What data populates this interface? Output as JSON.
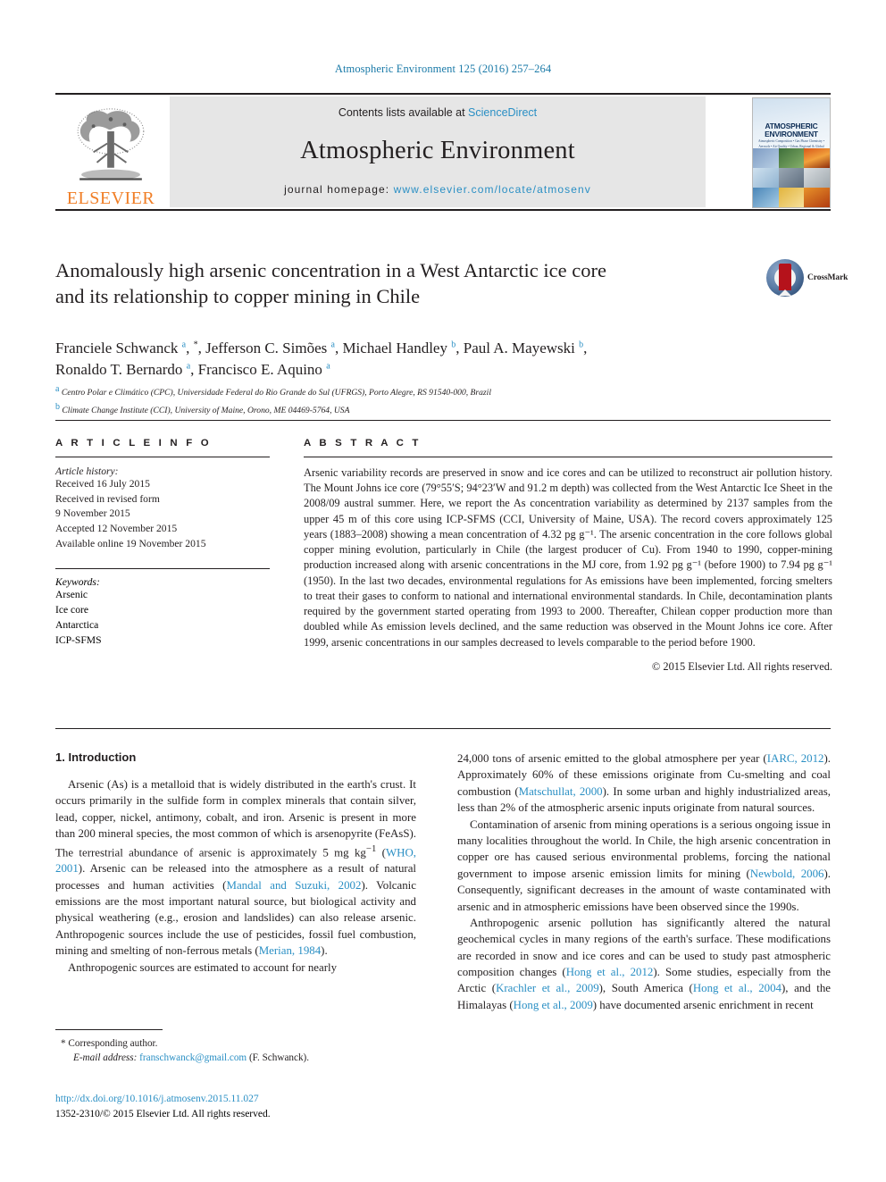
{
  "header": {
    "journal_reference": "Atmospheric Environment 125 (2016) 257–264"
  },
  "masthead": {
    "publisher_name": "ELSEVIER",
    "contents_prefix": "Contents lists available at ",
    "contents_link": "ScienceDirect",
    "journal_title": "Atmospheric Environment",
    "homepage_label": "journal homepage: ",
    "homepage_url": "www.elsevier.com/locate/atmosenv",
    "cover_title_line1": "ATMOSPHERIC",
    "cover_title_line2": "ENVIRONMENT",
    "cover_subtitle": "Atmospheric Composition • Gas Phase Chemistry • Aerosols • Air Quality • Urban, Regional & Global Scales"
  },
  "article": {
    "title_line1": "Anomalously high arsenic concentration in a West Antarctic ice core",
    "title_line2": "and its relationship to copper mining in Chile",
    "crossmark_label": "CrossMark",
    "authors_line1": "Franciele Schwanck <sup>a</sup>, <sup class=\"star\">*</sup>, Jefferson C. Simões <sup>a</sup>, Michael Handley <sup>b</sup>, Paul A. Mayewski <sup>b</sup>,",
    "authors_line2": "Ronaldo T. Bernardo <sup>a</sup>, Francisco E. Aquino <sup>a</sup>",
    "affiliation_a": "Centro Polar e Climático (CPC), Universidade Federal do Rio Grande do Sul (UFRGS), Porto Alegre, RS 91540-000, Brazil",
    "affiliation_b": "Climate Change Institute (CCI), University of Maine, Orono, ME 04469-5764, USA"
  },
  "article_info": {
    "heading": "A R T I C L E  I N F O",
    "history_label": "Article history:",
    "history": [
      "Received 16 July 2015",
      "Received in revised form",
      "9 November 2015",
      "Accepted 12 November 2015",
      "Available online 19 November 2015"
    ],
    "keywords_label": "Keywords:",
    "keywords": [
      "Arsenic",
      "Ice core",
      "Antarctica",
      "ICP-SFMS"
    ]
  },
  "abstract": {
    "heading": "A B S T R A C T",
    "text": "Arsenic variability records are preserved in snow and ice cores and can be utilized to reconstruct air pollution history. The Mount Johns ice core (79°55′S; 94°23′W and 91.2 m depth) was collected from the West Antarctic Ice Sheet in the 2008/09 austral summer. Here, we report the As concentration variability as determined by 2137 samples from the upper 45 m of this core using ICP-SFMS (CCI, University of Maine, USA). The record covers approximately 125 years (1883–2008) showing a mean concentration of 4.32 pg g⁻¹. The arsenic concentration in the core follows global copper mining evolution, particularly in Chile (the largest producer of Cu). From 1940 to 1990, copper-mining production increased along with arsenic concentrations in the MJ core, from 1.92 pg g⁻¹ (before 1900) to 7.94 pg g⁻¹ (1950). In the last two decades, environmental regulations for As emissions have been implemented, forcing smelters to treat their gases to conform to national and international environmental standards. In Chile, decontamination plants required by the government started operating from 1993 to 2000. Thereafter, Chilean copper production more than doubled while As emission levels declined, and the same reduction was observed in the Mount Johns ice core. After 1999, arsenic concentrations in our samples decreased to levels comparable to the period before 1900.",
    "copyright": "© 2015 Elsevier Ltd. All rights reserved."
  },
  "introduction": {
    "section_number_title": "1. Introduction",
    "left_paragraph_1_a": "Arsenic (As) is a metalloid that is widely distributed in the earth's crust. It occurs primarily in the sulfide form in complex minerals that contain silver, lead, copper, nickel, antimony, cobalt, and iron. Arsenic is present in more than 200 mineral species, the most common of which is arsenopyrite (FeAsS). The terrestrial abundance of arsenic is approximately 5 mg kg",
    "left_paragraph_1_sup": "−1",
    "left_paragraph_1_b": " (",
    "ref_who": "WHO, 2001",
    "left_paragraph_1_c": "). Arsenic can be released into the atmosphere as a result of natural processes and human activities (",
    "ref_mandal": "Mandal and Suzuki, 2002",
    "left_paragraph_1_d": "). Volcanic emissions are the most important natural source, but biological activity and physical weathering (e.g., erosion and landslides) can also release arsenic. Anthropogenic sources include the use of pesticides, fossil fuel combustion, mining and smelting of non-ferrous metals (",
    "ref_merian": "Merian, 1984",
    "left_paragraph_1_e": ").",
    "left_paragraph_2": "Anthropogenic sources are estimated to account for nearly",
    "right_paragraph_1_a": "24,000 tons of arsenic emitted to the global atmosphere per year (",
    "ref_iarc": "IARC, 2012",
    "right_paragraph_1_b": "). Approximately 60% of these emissions originate from Cu-smelting and coal combustion (",
    "ref_matschullat": "Matschullat, 2000",
    "right_paragraph_1_c": "). In some urban and highly industrialized areas, less than 2% of the atmospheric arsenic inputs originate from natural sources.",
    "right_paragraph_2_a": "Contamination of arsenic from mining operations is a serious ongoing issue in many localities throughout the world. In Chile, the high arsenic concentration in copper ore has caused serious environmental problems, forcing the national government to impose arsenic emission limits for mining (",
    "ref_newbold": "Newbold, 2006",
    "right_paragraph_2_b": "). Consequently, significant decreases in the amount of waste contaminated with arsenic and in atmospheric emissions have been observed since the 1990s.",
    "right_paragraph_3_a": "Anthropogenic arsenic pollution has significantly altered the natural geochemical cycles in many regions of the earth's surface. These modifications are recorded in snow and ice cores and can be used to study past atmospheric composition changes (",
    "ref_hong2012": "Hong et al., 2012",
    "right_paragraph_3_b": "). Some studies, especially from the Arctic (",
    "ref_krachler": "Krachler et al., 2009",
    "right_paragraph_3_c": "), South America (",
    "ref_hong2004": "Hong et al., 2004",
    "right_paragraph_3_d": "), and the Himalayas (",
    "ref_hong2009": "Hong et al., 2009",
    "right_paragraph_3_e": ") have documented arsenic enrichment in recent"
  },
  "footnotes": {
    "corresponding_marker": "*",
    "corresponding_label": " Corresponding author.",
    "email_label": "E-mail address:",
    "email_address": "franschwanck@gmail.com",
    "email_suffix": " (F. Schwanck).",
    "doi_url": "http://dx.doi.org/10.1016/j.atmosenv.2015.11.027",
    "issn_line": "1352-2310/© 2015 Elsevier Ltd. All rights reserved."
  },
  "colors": {
    "link_blue": "#2a8fc4",
    "header_blue": "#1a7aa8",
    "elsevier_orange": "#f07e26",
    "band_grey": "#e6e6e6"
  }
}
